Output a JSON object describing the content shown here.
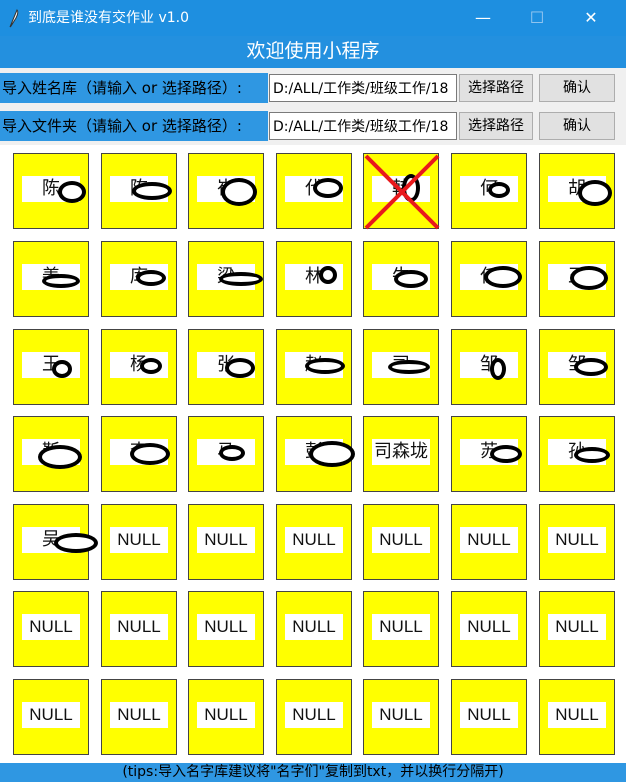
{
  "window": {
    "title": "到底是谁没有交作业 v1.0",
    "icon": "feather-icon",
    "controls": {
      "minimize": "—",
      "maximize": "☐",
      "close": "✕"
    }
  },
  "banner": "欢迎使用小程序",
  "rows": [
    {
      "label": "导入姓名库（请输入 or 选择路径）:",
      "value": "D:/ALL/工作类/班级工作/18",
      "browse": "选择路径",
      "confirm": "确认"
    },
    {
      "label": "导入文件夹（请输入 or 选择路径）:",
      "value": "D:/ALL/工作类/班级工作/18",
      "browse": "选择路径",
      "confirm": "确认"
    }
  ],
  "grid": [
    [
      {
        "name": "陈",
        "redacted": true
      },
      {
        "name": "陈",
        "redacted": true
      },
      {
        "name": "崔",
        "redacted": true
      },
      {
        "name": "代",
        "redacted": true
      },
      {
        "name": "韩",
        "redacted": true,
        "crossed": true
      },
      {
        "name": "何",
        "redacted": true
      },
      {
        "name": "胡",
        "redacted": true
      }
    ],
    [
      {
        "name": "姜",
        "redacted": true
      },
      {
        "name": "库",
        "redacted": true
      },
      {
        "name": "梁",
        "redacted": true
      },
      {
        "name": "林",
        "redacted": true
      },
      {
        "name": "牛",
        "redacted": true
      },
      {
        "name": "任",
        "redacted": true
      },
      {
        "name": "王",
        "redacted": true
      }
    ],
    [
      {
        "name": "王",
        "redacted": true
      },
      {
        "name": "杨",
        "redacted": true
      },
      {
        "name": "张",
        "redacted": true
      },
      {
        "name": "赵",
        "redacted": true
      },
      {
        "name": "司",
        "redacted": true
      },
      {
        "name": "邹",
        "redacted": true
      },
      {
        "name": "邹",
        "redacted": true
      }
    ],
    [
      {
        "name": "靳",
        "redacted": true
      },
      {
        "name": "李",
        "redacted": true
      },
      {
        "name": "马",
        "redacted": true
      },
      {
        "name": "彭",
        "redacted": true
      },
      {
        "name": "司森垅",
        "redacted": false
      },
      {
        "name": "苏",
        "redacted": true
      },
      {
        "name": "孙",
        "redacted": true
      }
    ],
    [
      {
        "name": "吴",
        "redacted": true
      },
      {
        "name": "NULL"
      },
      {
        "name": "NULL"
      },
      {
        "name": "NULL"
      },
      {
        "name": "NULL"
      },
      {
        "name": "NULL"
      },
      {
        "name": "NULL"
      }
    ],
    [
      {
        "name": "NULL"
      },
      {
        "name": "NULL"
      },
      {
        "name": "NULL"
      },
      {
        "name": "NULL"
      },
      {
        "name": "NULL"
      },
      {
        "name": "NULL"
      },
      {
        "name": "NULL"
      }
    ],
    [
      {
        "name": "NULL"
      },
      {
        "name": "NULL"
      },
      {
        "name": "NULL"
      },
      {
        "name": "NULL"
      },
      {
        "name": "NULL"
      },
      {
        "name": "NULL"
      },
      {
        "name": "NULL"
      }
    ]
  ],
  "status": "(tips:导入名字库建议将\"名字们\"复制到txt，并以换行分隔开)",
  "colors": {
    "accent": "#2390df",
    "cell": "#ffff00",
    "cross": "#e8191c"
  }
}
